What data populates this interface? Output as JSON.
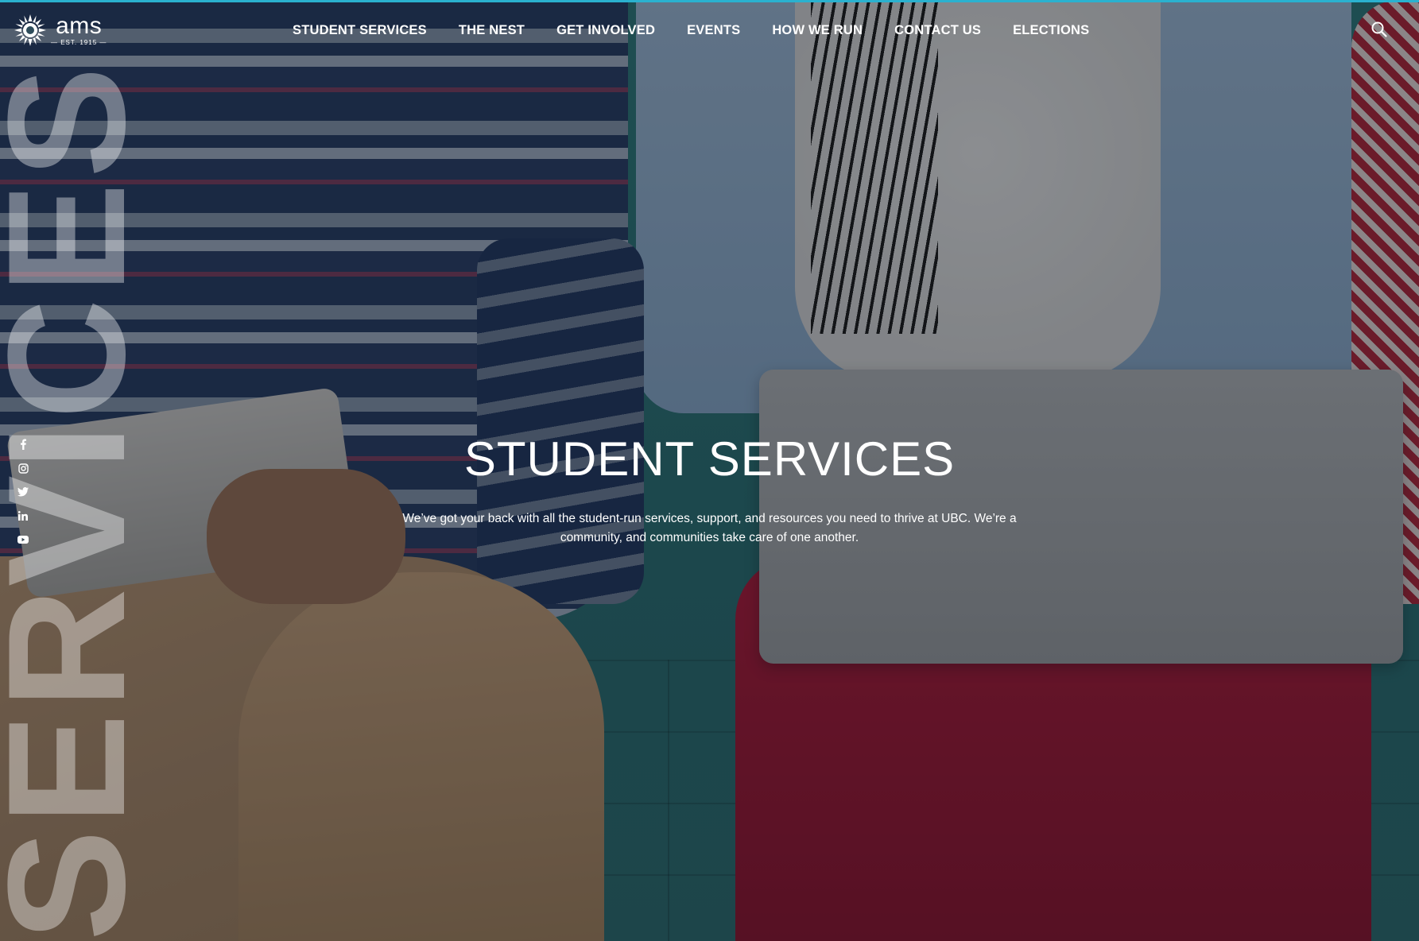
{
  "header": {
    "logo": {
      "name": "ams",
      "established": "— EST. 1915 —"
    },
    "nav": [
      {
        "label": "STUDENT SERVICES"
      },
      {
        "label": "THE NEST"
      },
      {
        "label": "GET INVOLVED"
      },
      {
        "label": "EVENTS"
      },
      {
        "label": "HOW WE RUN"
      },
      {
        "label": "CONTACT US"
      },
      {
        "label": "ELECTIONS"
      }
    ],
    "search_icon": "search-icon",
    "accent_color": "#2ab1cf"
  },
  "social": [
    {
      "icon": "facebook-icon"
    },
    {
      "icon": "instagram-icon"
    },
    {
      "icon": "twitter-icon"
    },
    {
      "icon": "linkedin-icon"
    },
    {
      "icon": "youtube-icon"
    }
  ],
  "hero": {
    "watermark": "SERVICES",
    "title": "STUDENT SERVICES",
    "description": "We’ve got your back with all the student-run services, support, and resources you need to thrive at UBC. We’re a community, and communities take care of one another."
  }
}
